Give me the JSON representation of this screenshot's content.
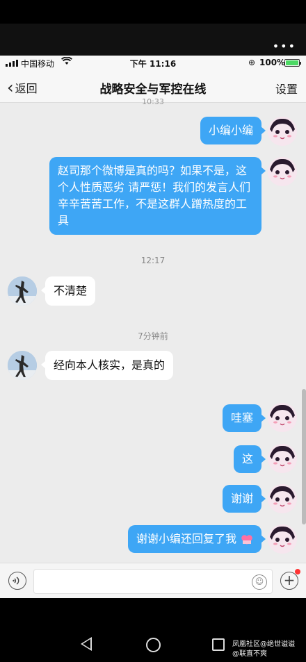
{
  "statusbar": {
    "carrier": "中国移动",
    "time": "下午 11:16",
    "battery_pct": "100%",
    "battery_level": 1.0
  },
  "navbar": {
    "back_label": "返回",
    "title": "战略安全与军控在线",
    "settings_label": "设置"
  },
  "messages": {
    "m1": "小编小编",
    "m2": "赵司那个微博是真的吗？如果不是，这个人性质恶劣 请严惩！我们的发言人们辛辛苦苦工作，不是这群人蹭热度的工具",
    "m3": "不清楚",
    "m4": "经向本人核实，是真的",
    "m5": "哇塞",
    "m6": "这",
    "m7": "谢谢",
    "m8": "谢谢小编还回复了我"
  },
  "timestamps": {
    "partial_top": "10:33",
    "t1": "12:17",
    "t2": "7分钟前"
  },
  "input": {
    "placeholder": ""
  },
  "watermark": {
    "line1": "凤凰社区@绝世谥谥",
    "line2": "@联直不爽"
  },
  "colors": {
    "outgoing_bubble": "#3ea6f5",
    "incoming_bubble": "#ffffff",
    "chat_background": "#ececec"
  }
}
